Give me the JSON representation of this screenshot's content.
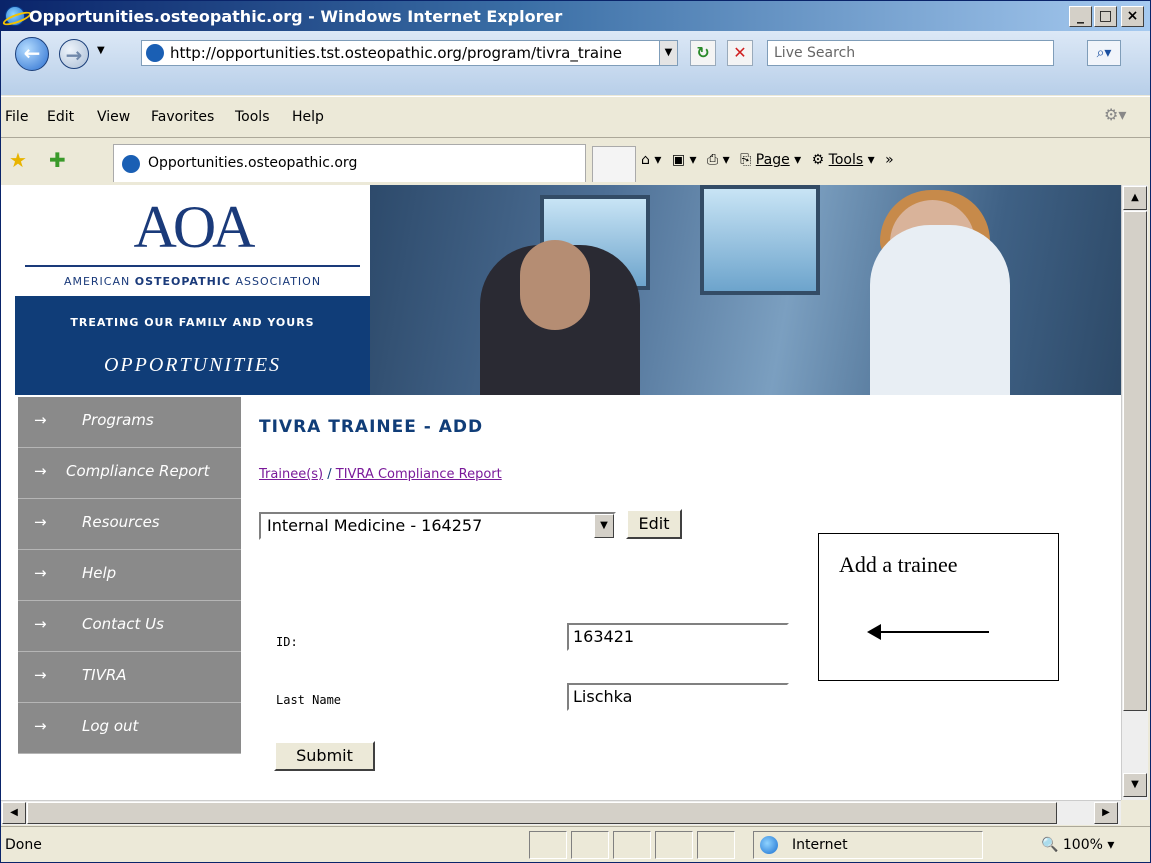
{
  "window": {
    "title": "Opportunities.osteopathic.org - Windows Internet Explorer",
    "minimize": "_",
    "maximize": "□",
    "close": "×"
  },
  "addressbar": {
    "url": "http://opportunities.tst.osteopathic.org/program/tivra_traine",
    "search_placeholder": "Live Search"
  },
  "menu": {
    "items": [
      "File",
      "Edit",
      "View",
      "Favorites",
      "Tools",
      "Help"
    ]
  },
  "favorites": {
    "tab_label": "Opportunities.osteopathic.org",
    "page_label": "Page",
    "tools_label": "Tools"
  },
  "banner": {
    "logo_mark": "AOA",
    "org_name_prefix": "AMERICAN ",
    "org_name_bold": "OSTEOPATHIC",
    "org_name_suffix": " ASSOCIATION",
    "tagline": "TREATING OUR FAMILY AND YOURS",
    "section": "OPPORTUNITIES"
  },
  "sidenav": {
    "items": [
      {
        "label": "Programs"
      },
      {
        "label": "Compliance Report"
      },
      {
        "label": "Resources"
      },
      {
        "label": "Help"
      },
      {
        "label": "Contact Us"
      },
      {
        "label": "TIVRA"
      },
      {
        "label": "Log out"
      }
    ],
    "arrow": "→"
  },
  "main": {
    "heading": "TIVRA TRAINEE - ADD",
    "link_trainees": "Trainee(s)",
    "link_separator": " / ",
    "link_compliance": "TIVRA Compliance Report",
    "program_select": "Internal Medicine - 164257",
    "edit_button": "Edit",
    "id_label": "ID:",
    "id_value": "163421",
    "lastname_label": "Last Name",
    "lastname_value": "Lischka",
    "submit_button": "Submit"
  },
  "callout": {
    "text": "Add a trainee"
  },
  "statusbar": {
    "status": "Done",
    "zone": "Internet",
    "zoom": "100%"
  }
}
